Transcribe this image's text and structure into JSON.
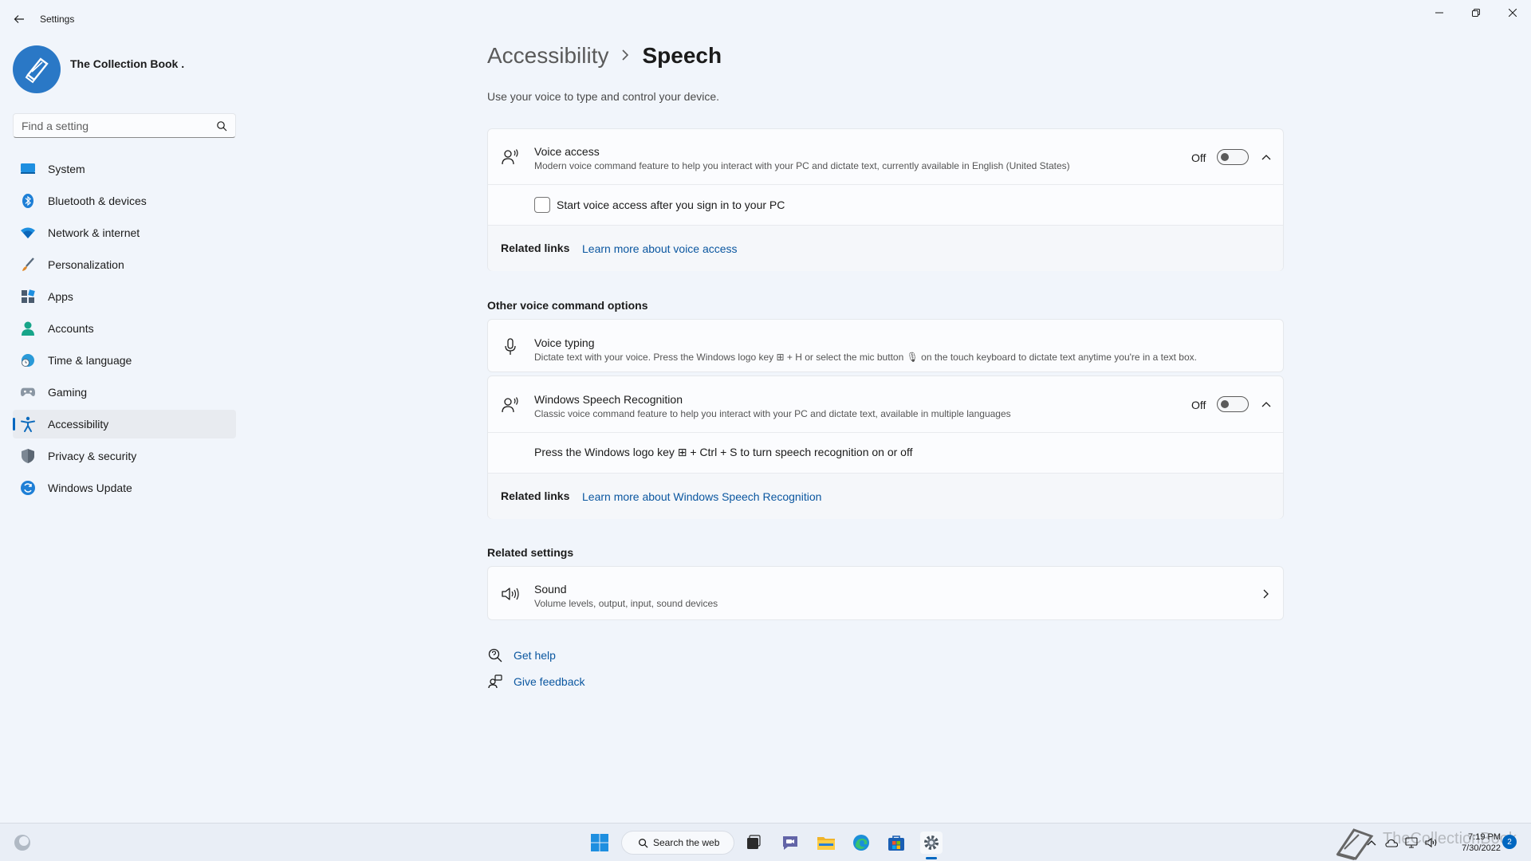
{
  "window": {
    "title": "Settings",
    "back_icon": "back-arrow-icon",
    "controls": [
      "minimize-icon",
      "restore-icon",
      "close-icon"
    ]
  },
  "profile": {
    "name": "The Collection Book .",
    "avatar_icon": "book-icon",
    "avatar_color": "#2a78c6"
  },
  "search": {
    "placeholder": "Find a setting",
    "value": ""
  },
  "nav": {
    "active_index": 8,
    "accent": "#0067c0",
    "items": [
      {
        "label": "System",
        "icon": "monitor-icon"
      },
      {
        "label": "Bluetooth & devices",
        "icon": "bluetooth-icon"
      },
      {
        "label": "Network & internet",
        "icon": "wifi-icon"
      },
      {
        "label": "Personalization",
        "icon": "brush-icon"
      },
      {
        "label": "Apps",
        "icon": "apps-icon"
      },
      {
        "label": "Accounts",
        "icon": "person-icon"
      },
      {
        "label": "Time & language",
        "icon": "globe-clock-icon"
      },
      {
        "label": "Gaming",
        "icon": "gamepad-icon"
      },
      {
        "label": "Accessibility",
        "icon": "accessibility-icon"
      },
      {
        "label": "Privacy & security",
        "icon": "shield-icon"
      },
      {
        "label": "Windows Update",
        "icon": "update-icon"
      }
    ]
  },
  "main": {
    "breadcrumb_parent": "Accessibility",
    "breadcrumb_current": "Speech",
    "subtitle": "Use your voice to type and control your device.",
    "voice_access": {
      "title": "Voice access",
      "description": "Modern voice command feature to help you interact with your PC and dictate text, currently available in English (United States)",
      "state": "Off",
      "checkbox_label": "Start voice access after you sign in to your PC",
      "related_links_label": "Related links",
      "link": "Learn more about voice access"
    },
    "other_options_heading": "Other voice command options",
    "voice_typing": {
      "title": "Voice typing",
      "description": "Dictate text with your voice. Press the Windows logo key ⊞ + H or select the mic button 🎙 on the touch keyboard to dictate text anytime you're in a text box."
    },
    "speech_recognition": {
      "title": "Windows Speech Recognition",
      "description": "Classic voice command feature to help you interact with your PC and dictate text, available in multiple languages",
      "state": "Off",
      "shortcut_text": "Press the Windows logo key ⊞ + Ctrl + S to turn speech recognition on or off",
      "related_links_label": "Related links",
      "link": "Learn more about Windows Speech Recognition"
    },
    "related_settings_heading": "Related settings",
    "sound": {
      "title": "Sound",
      "description": "Volume levels, output, input, sound devices"
    },
    "get_help": "Get help",
    "give_feedback": "Give feedback"
  },
  "taskbar": {
    "search_label": "Search the web",
    "time": "7:19 PM",
    "date": "7/30/2022",
    "notification_count": "2",
    "watermark": "TheCollectionBook"
  }
}
